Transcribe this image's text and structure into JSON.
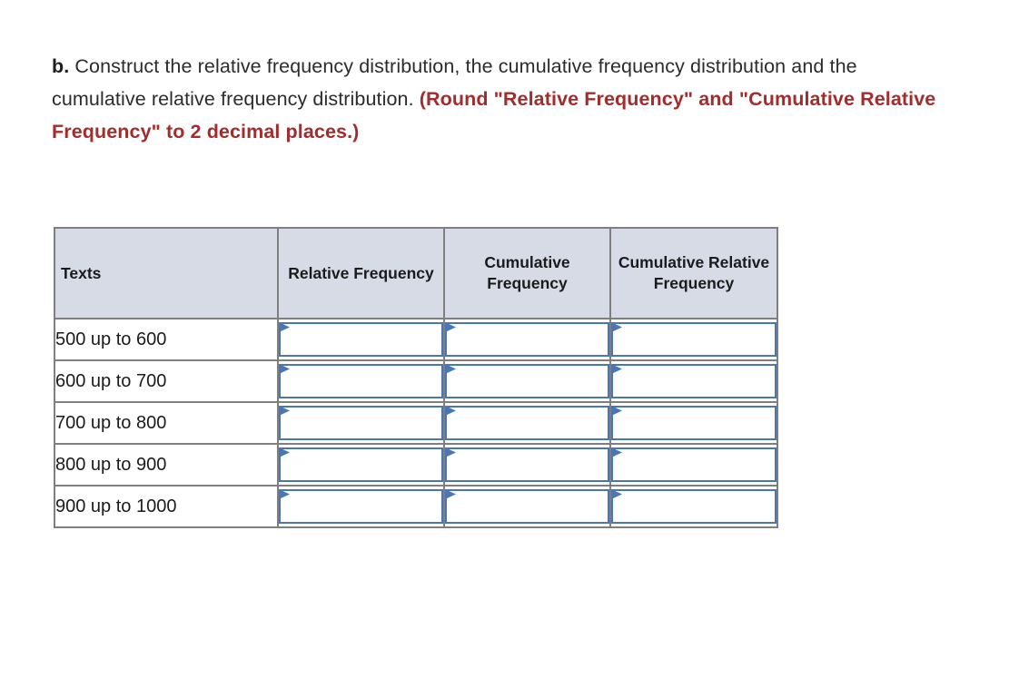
{
  "question": {
    "label": "b.",
    "body": " Construct the relative frequency distribution, the cumulative frequency distribution and the cumulative relative frequency distribution. ",
    "emphasis": "(Round \"Relative Frequency\" and \"Cumulative Relative Frequency\" to 2 decimal places.)"
  },
  "colors": {
    "header_background": "#d6dbe5",
    "table_border": "#7f7f7f",
    "input_border": "#4a77b4",
    "emphasis_text": "#a32c2c",
    "body_text": "#2c2c2c",
    "page_background": "#ffffff"
  },
  "table": {
    "headers": [
      "Texts",
      "Relative Frequency",
      "Cumulative Frequency",
      "Cumulative Relative Frequency"
    ],
    "rows": [
      {
        "category": "500 up to 600",
        "relative_frequency": "",
        "cumulative_frequency": "",
        "cumulative_relative_frequency": ""
      },
      {
        "category": "600 up to 700",
        "relative_frequency": "",
        "cumulative_frequency": "",
        "cumulative_relative_frequency": ""
      },
      {
        "category": "700 up to 800",
        "relative_frequency": "",
        "cumulative_frequency": "",
        "cumulative_relative_frequency": ""
      },
      {
        "category": "800 up to 900",
        "relative_frequency": "",
        "cumulative_frequency": "",
        "cumulative_relative_frequency": ""
      },
      {
        "category": "900 up to 1000",
        "relative_frequency": "",
        "cumulative_frequency": "",
        "cumulative_relative_frequency": ""
      }
    ]
  }
}
